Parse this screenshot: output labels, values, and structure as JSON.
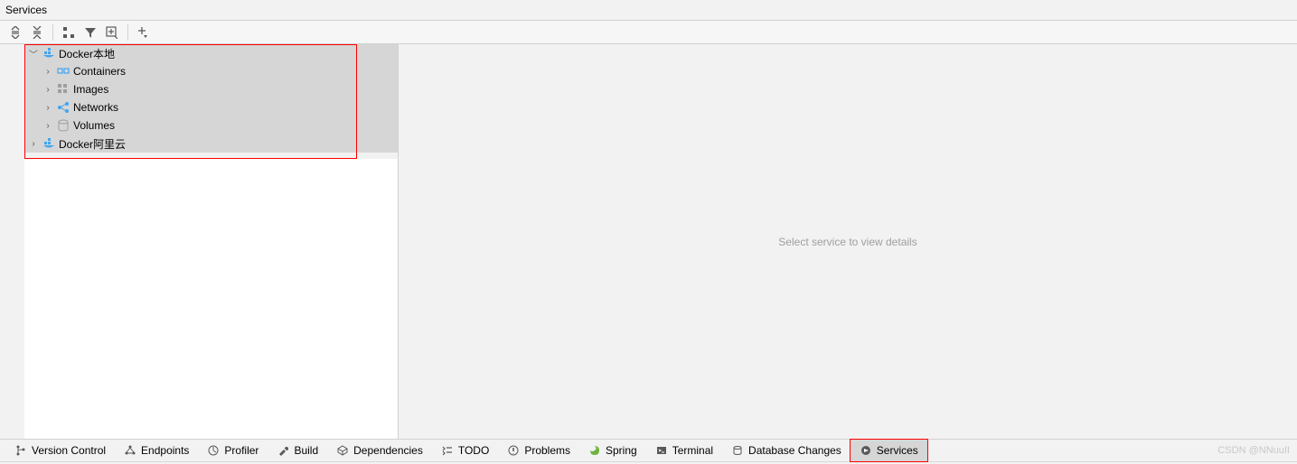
{
  "title": "Services",
  "detail_placeholder": "Select service to view details",
  "tree": {
    "docker_local": "Docker本地",
    "containers": "Containers",
    "images": "Images",
    "networks": "Networks",
    "volumes": "Volumes",
    "docker_aliyun": "Docker阿里云"
  },
  "bottom_tabs": {
    "version_control": "Version Control",
    "endpoints": "Endpoints",
    "profiler": "Profiler",
    "build": "Build",
    "dependencies": "Dependencies",
    "todo": "TODO",
    "problems": "Problems",
    "spring": "Spring",
    "terminal": "Terminal",
    "database_changes": "Database Changes",
    "services": "Services"
  },
  "watermark": "CSDN @NNuuII"
}
